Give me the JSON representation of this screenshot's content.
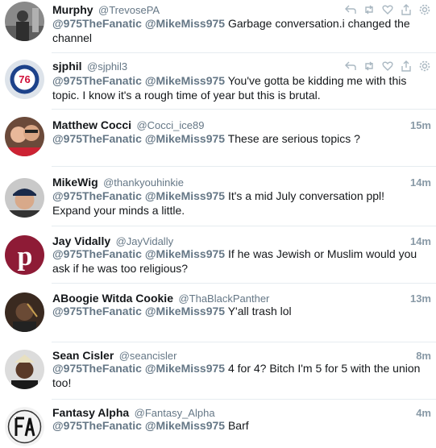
{
  "tweets": [
    {
      "name": "Murphy",
      "handle": "@TrevosePA",
      "time": "",
      "mentions": [
        "@975TheFanatic",
        "@MikeMiss975"
      ],
      "text": "Garbage conversation.i changed the channel",
      "avatar": "person-photo-avatar"
    },
    {
      "name": "sjphil",
      "handle": "@sjphil3",
      "time": "",
      "mentions": [
        "@975TheFanatic",
        "@MikeMiss975"
      ],
      "text": "You've gotta be kidding me with this topic. I know it's a rough time of year but this is brutal.",
      "avatar": "76ers-logo-avatar"
    },
    {
      "name": "Matthew Cocci",
      "handle": "@Cocci_ice89",
      "time": "15m",
      "mentions": [
        "@975TheFanatic",
        "@MikeMiss975"
      ],
      "text": "These are serious topics ?",
      "avatar": "couple-photo-avatar"
    },
    {
      "name": "MikeWig",
      "handle": "@thankyouhinkie",
      "time": "14m",
      "mentions": [
        "@975TheFanatic",
        "@MikeMiss975"
      ],
      "text": "It's a mid July conversation ppl! Expand your minds a little.",
      "avatar": "man-cap-avatar"
    },
    {
      "name": "Jay Vidally",
      "handle": "@JayVidally",
      "time": "14m",
      "mentions": [
        "@975TheFanatic",
        "@MikeMiss975"
      ],
      "text": "If he was Jewish or Muslim would you ask if he was too religious?",
      "avatar": "phillies-p-logo-avatar"
    },
    {
      "name": "ABoogie Witda Cookie",
      "handle": "@ThaBlackPanther",
      "time": "13m",
      "mentions": [
        "@975TheFanatic",
        "@MikeMiss975"
      ],
      "text": "Y'all trash lol",
      "avatar": "dark-photo-avatar"
    },
    {
      "name": "Sean Cisler",
      "handle": "@seancisler",
      "time": "8m",
      "mentions": [
        "@975TheFanatic",
        "@MikeMiss975"
      ],
      "text": "4 for 4? Bitch I'm 5 for 5 with the union too!",
      "avatar": "person-photo-avatar"
    },
    {
      "name": "Fantasy Alpha",
      "handle": "@Fantasy_Alpha",
      "time": "4m",
      "mentions": [
        "@975TheFanatic",
        "@MikeMiss975"
      ],
      "text": "Barf",
      "avatar": "fa-logo-avatar"
    }
  ],
  "colors": {
    "mention": "#657786",
    "time": "#8899a6",
    "divider": "#e6ecf0",
    "icon": "#aab8c2"
  },
  "action_icons": [
    "reply-icon",
    "retweet-icon",
    "like-icon",
    "share-icon",
    "settings-gear-icon"
  ]
}
